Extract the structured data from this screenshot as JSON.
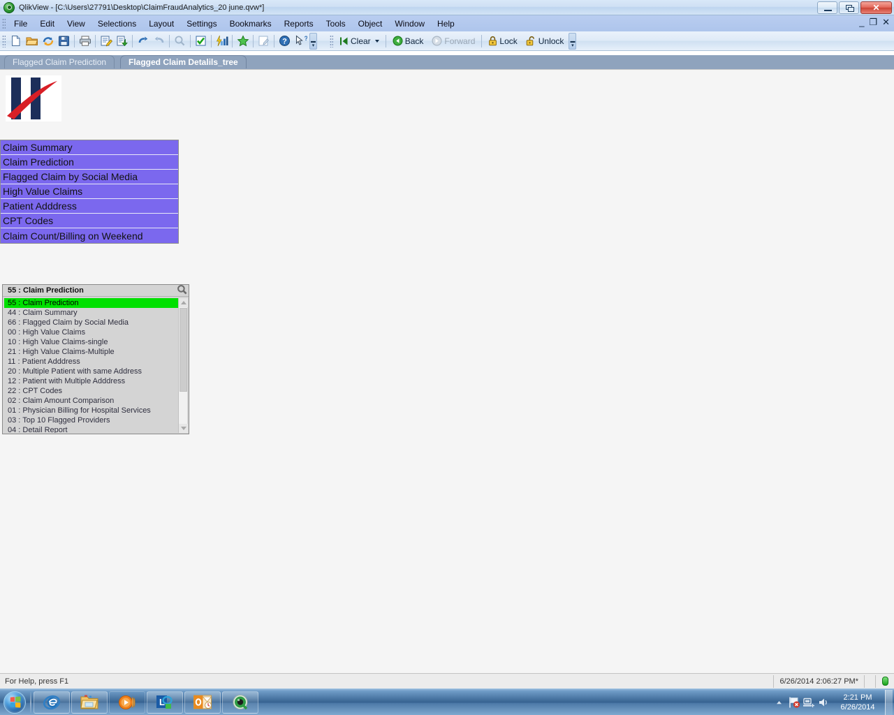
{
  "window": {
    "app_name": "QlikView",
    "title": "QlikView - [C:\\Users\\27791\\Desktop\\ClaimFraudAnalytics_20 june.qvw*]",
    "controls": {
      "minimize": "Minimize",
      "restore": "Restore",
      "close": "Close"
    },
    "mdi_controls": {
      "minimize": "_",
      "restore": "❐",
      "close": "✕"
    }
  },
  "menu": {
    "items": [
      {
        "label": "File"
      },
      {
        "label": "Edit"
      },
      {
        "label": "View"
      },
      {
        "label": "Selections"
      },
      {
        "label": "Layout"
      },
      {
        "label": "Settings"
      },
      {
        "label": "Bookmarks"
      },
      {
        "label": "Reports"
      },
      {
        "label": "Tools"
      },
      {
        "label": "Object"
      },
      {
        "label": "Window"
      },
      {
        "label": "Help"
      }
    ]
  },
  "toolbar": {
    "standard_icons": [
      {
        "name": "new-document-icon",
        "tooltip": "New"
      },
      {
        "name": "open-document-icon",
        "tooltip": "Open"
      },
      {
        "name": "reload-icon",
        "tooltip": "Reload"
      },
      {
        "name": "save-icon",
        "tooltip": "Save"
      },
      {
        "name": "print-icon",
        "tooltip": "Print"
      },
      {
        "name": "edit-script-icon",
        "tooltip": "Edit Script"
      },
      {
        "name": "reload-data-icon",
        "tooltip": "Reload Data"
      },
      {
        "name": "undo-icon",
        "tooltip": "Undo"
      },
      {
        "name": "redo-icon",
        "tooltip": "Redo"
      },
      {
        "name": "search-icon",
        "tooltip": "Search"
      },
      {
        "name": "current-selections-icon",
        "tooltip": "Current Selections"
      },
      {
        "name": "quick-chart-icon",
        "tooltip": "Quick Chart Wizard"
      },
      {
        "name": "bookmark-star-icon",
        "tooltip": "Bookmarks"
      },
      {
        "name": "edit-sheet-icon",
        "tooltip": "Edit Sheet"
      },
      {
        "name": "help-icon",
        "tooltip": "Help"
      },
      {
        "name": "context-help-icon",
        "tooltip": "Context Help"
      }
    ],
    "navigation": {
      "clear_label": "Clear",
      "back_label": "Back",
      "forward_label": "Forward",
      "lock_label": "Lock",
      "unlock_label": "Unlock",
      "forward_disabled": true
    }
  },
  "sheet_tabs": [
    {
      "label": "Flagged Claim Prediction",
      "active": false
    },
    {
      "label": "Flagged Claim Detalils_tree",
      "active": true
    }
  ],
  "logo": {
    "name": "company-logo",
    "alt": "H logo"
  },
  "nav_buttons": [
    {
      "label": "Claim Summary"
    },
    {
      "label": "Claim Prediction"
    },
    {
      "label": "Flagged Claim by Social Media"
    },
    {
      "label": "High Value Claims"
    },
    {
      "label": "Patient Adddress"
    },
    {
      "label": "CPT Codes"
    },
    {
      "label": "Claim Count/Billing on Weekend"
    }
  ],
  "listbox": {
    "caption": "55 : Claim Prediction",
    "search_icon": "search-icon",
    "rows": [
      {
        "label": "55 : Claim Prediction",
        "selected": true
      },
      {
        "label": "44 : Claim Summary",
        "selected": false
      },
      {
        "label": "66 : Flagged Claim by Social Media",
        "selected": false
      },
      {
        "label": "00 : High Value Claims",
        "selected": false
      },
      {
        "label": "10 : High Value Claims-single",
        "selected": false
      },
      {
        "label": "21 : High Value Claims-Multiple",
        "selected": false
      },
      {
        "label": "11 : Patient Adddress",
        "selected": false
      },
      {
        "label": "20 : Multiple Patient with same Address",
        "selected": false
      },
      {
        "label": "12 : Patient with Multiple Adddress",
        "selected": false
      },
      {
        "label": "22 : CPT Codes",
        "selected": false
      },
      {
        "label": "02 : Claim Amount Comparison",
        "selected": false
      },
      {
        "label": "01 : Physician Billing for Hospital Services",
        "selected": false
      },
      {
        "label": "03 : Top 10 Flagged Providers",
        "selected": false
      },
      {
        "label": "04 : Detail Report",
        "selected": false
      }
    ]
  },
  "statusbar": {
    "help_text": "For Help, press F1",
    "datetime": "6/26/2014 2:06:27 PM*"
  },
  "taskbar": {
    "start_label": "Start",
    "apps": [
      {
        "name": "internet-explorer-icon",
        "label": "Internet Explorer"
      },
      {
        "name": "file-explorer-icon",
        "label": "Windows Explorer"
      },
      {
        "name": "media-player-icon",
        "label": "Windows Media Player"
      },
      {
        "name": "lync-icon",
        "label": "Microsoft Lync"
      },
      {
        "name": "outlook-icon",
        "label": "Microsoft Outlook"
      },
      {
        "name": "qlikview-icon",
        "label": "QlikView"
      }
    ],
    "tray": [
      {
        "name": "show-hidden-icons-icon"
      },
      {
        "name": "action-center-flag-icon"
      },
      {
        "name": "network-icon"
      },
      {
        "name": "volume-icon"
      }
    ],
    "clock": {
      "time": "2:21 PM",
      "date": "6/26/2014"
    }
  },
  "colors": {
    "nav_button": "#7b68ee",
    "selected_row": "#00e000",
    "logo_navy": "#1c2e5a",
    "logo_red": "#d81f26",
    "titlebar": "#cfe0f4",
    "taskbar": "#35618f"
  }
}
